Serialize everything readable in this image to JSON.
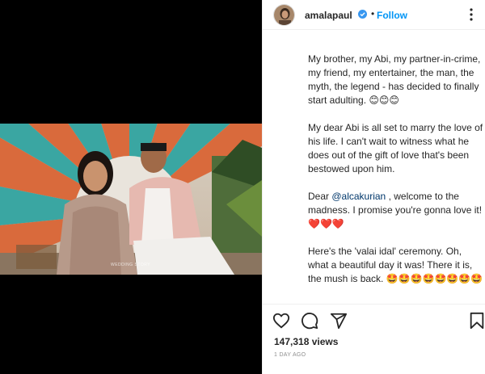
{
  "post": {
    "username": "amalapaul",
    "follow_label": "Follow",
    "separator": "•",
    "verified_icon": "verified-badge-icon"
  },
  "caption": {
    "para1": "My brother, my Abi, my partner-in-crime, my friend, my entertainer, the man, the myth, the legend - has decided to finally start adulting.",
    "para1_emoji": "😊😊😊",
    "para2": "My dear Abi is all set to marry the love of his life. I can't wait to witness what he does out of the gift of love that's been bestowed upon him.",
    "para3_pre": "Dear ",
    "mention": "@alcakurian",
    "para3_post": " , welcome to the madness. I promise you're gonna love it!",
    "para3_emoji": "❤️❤️❤️",
    "para4": "Here's the 'valai idal' ceremony. Oh, what a beautiful day it was! There it is, the mush is back.",
    "para4_emoji": "🤩🤩🤩🤩🤩🤩🤩🤩"
  },
  "engagement": {
    "views": "147,318 views",
    "timestamp": "1 DAY AGO"
  },
  "media": {
    "watermark": "WEDDING STORY"
  },
  "icons": [
    "heart-icon",
    "comment-icon",
    "share-icon",
    "save-icon",
    "more-icon"
  ],
  "colors": {
    "accent": "#0095f6",
    "mention": "#00376b",
    "heart": "#ed4956",
    "muted": "#8e8e8e"
  }
}
